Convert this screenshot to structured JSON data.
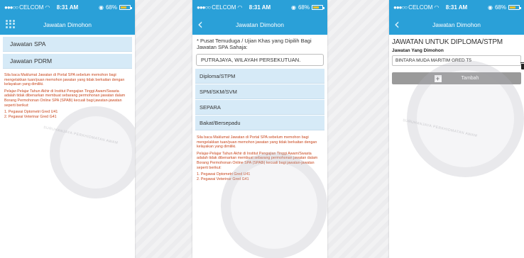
{
  "status": {
    "carrier": "CELCOM",
    "time": "8:31 AM",
    "battery": "68%"
  },
  "screen1": {
    "title": "Jawatan Dimohon",
    "menu": [
      {
        "label": "Jawatan SPA"
      },
      {
        "label": "Jawatan PDRM"
      }
    ],
    "info": [
      "Sila baca Maklumat Jawatan di Portal SPA sebelum memohon bagi mengelakkan tuan/puan memohon jawatan yang tidak berkaitan dengan kelayakan yang dimiliki.",
      "Pelajar-Pelajar Tahun Akhir di Institut Pengajian Tinggi Awam/Swasta adalah tidak dibenarkan membuat sebarang permohonan jawatan dalam Borang Permohonan Online SPA (SPA8i) kecuali bagi jawatan-jawatan seperti berikut:",
      "1. Pegawai Optometri Gred U41\n2. Pegawai Veterinar Gred G41"
    ]
  },
  "screen2": {
    "title": "Jawatan Dimohon",
    "pusat_label": "* Pusat Temuduga / Ujian Khas yang Dipilih Bagi Jawatan SPA Sahaja:",
    "pusat_value": "PUTRAJAYA, WILAYAH PERSEKUTUAN.",
    "options": [
      {
        "label": "Diploma/STPM"
      },
      {
        "label": "SPM/SKM/SVM"
      },
      {
        "label": "SEPARA"
      },
      {
        "label": "Bakat/Bersepadu"
      }
    ],
    "info": [
      "Sila baca Maklumat Jawatan di Portal SPA sebelum memohon bagi mengelakkan tuan/puan memohon jawatan yang tidak berkaitan dengan kelayakan yang dimiliki.",
      "Pelajar-Pelajar Tahun Akhir di Institut Pengajian Tinggi Awam/Swasta adalah tidak dibenarkan membuat sebarang permohonan jawatan dalam Borang Permohonan Online SPA (SPA8i) kecuali bagi jawatan-jawatan seperti berikut:",
      "1. Pegawai Optometri Gred U41\n2. Pegawai Veterinar Gred G41"
    ]
  },
  "screen3": {
    "title": "Jawatan Dimohon",
    "heading": "JAWATAN UNTUK DIPLOMA/STPM",
    "sub": "Jawatan Yang Dimohon",
    "jawatan_value": "BINTARA MUDA MARITIM GRED T5",
    "tambah_label": "Tambah"
  },
  "watermark_text": "SURUHANJAYA PERKHIDMATAN AWAM",
  "colors": {
    "header": "#2aa0d8",
    "row": "#d6eaf7",
    "info_text": "#c8461c"
  }
}
